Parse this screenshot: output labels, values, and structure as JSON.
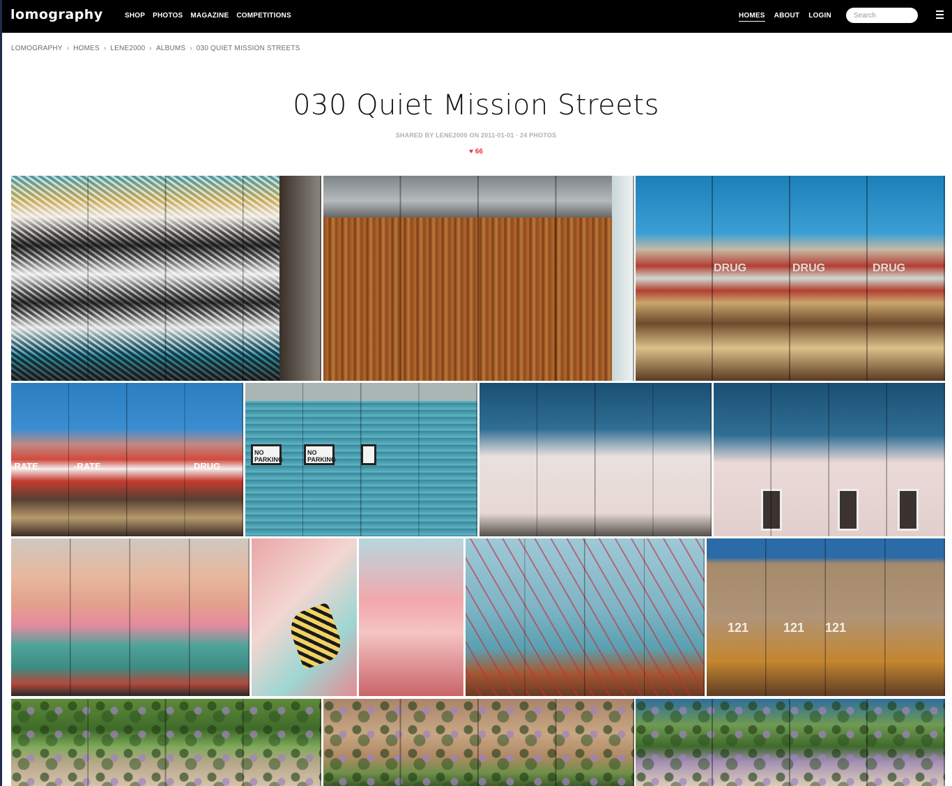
{
  "nav": {
    "logo": "lomography",
    "main": [
      "SHOP",
      "PHOTOS",
      "MAGAZINE",
      "COMPETITIONS"
    ],
    "right": [
      "HOMES",
      "ABOUT",
      "LOGIN"
    ],
    "active": "HOMES",
    "search_placeholder": "Search"
  },
  "breadcrumb": [
    "LOMOGRAPHY",
    "HOMES",
    "LENE2000",
    "ALBUMS",
    "030 QUIET MISSION STREETS"
  ],
  "album": {
    "title": "030 Quiet Mission Streets",
    "meta": "SHARED BY LENE2000 ON 2011-01-01 · 24 PHOTOS",
    "likes_icon": "heart-icon",
    "likes": "66",
    "like_color": "#e8343d"
  },
  "photos": [
    {
      "id": "photo-1",
      "subject": "feather mural"
    },
    {
      "id": "photo-2",
      "subject": "wooden wall"
    },
    {
      "id": "photo-3",
      "subject": "drug co sign"
    },
    {
      "id": "photo-4",
      "subject": "cut-rate drug facade"
    },
    {
      "id": "photo-5",
      "subject": "no parking sign"
    },
    {
      "id": "photo-6",
      "subject": "stucco wall window"
    },
    {
      "id": "photo-7",
      "subject": "stucco wall windows"
    },
    {
      "id": "photo-8",
      "subject": "tree mural"
    },
    {
      "id": "photo-9",
      "subject": "butterfly mural"
    },
    {
      "id": "photo-10",
      "subject": "pink mural"
    },
    {
      "id": "photo-11",
      "subject": "flower mural"
    },
    {
      "id": "photo-12",
      "subject": "wooden fence 121"
    },
    {
      "id": "photo-13",
      "subject": "lilac fence"
    },
    {
      "id": "photo-14",
      "subject": "lilac wall"
    },
    {
      "id": "photo-15",
      "subject": "lilac bush"
    }
  ],
  "photo_text": {
    "drug": "DRUG",
    "rate": "-RATE",
    "no_parking": "NO PARKING",
    "number": "121"
  }
}
